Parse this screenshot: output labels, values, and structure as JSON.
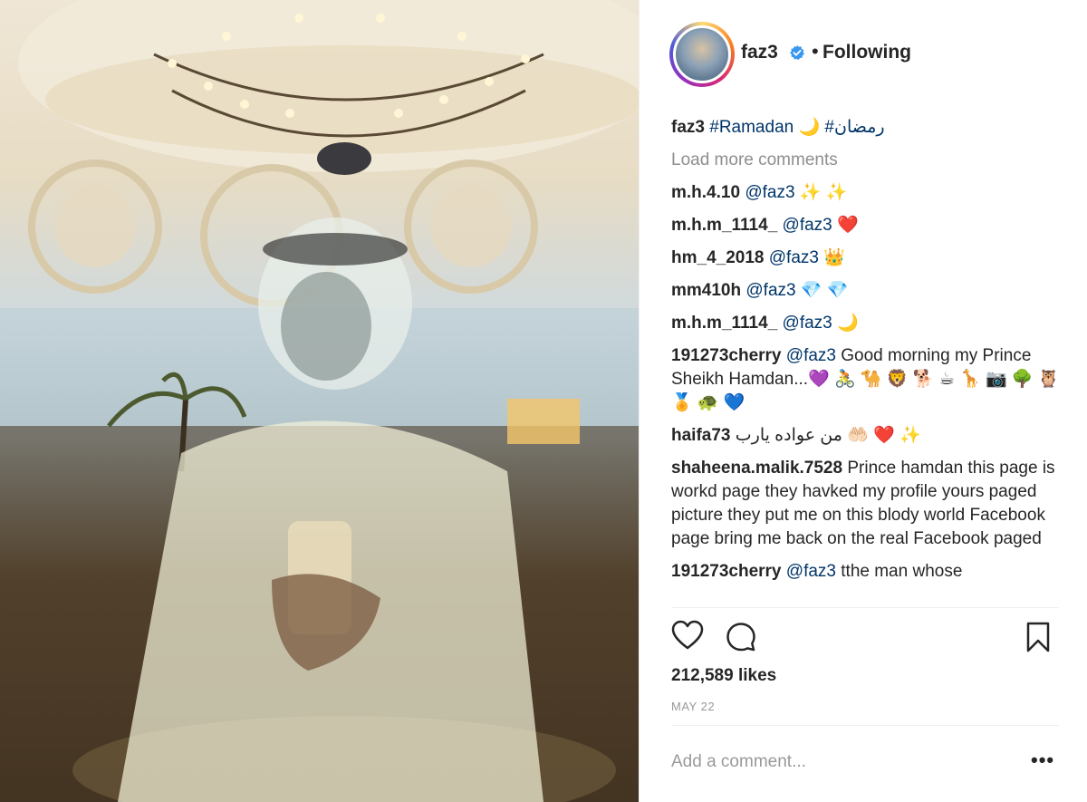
{
  "header": {
    "username": "faz3",
    "separator": "•",
    "follow_status": "Following"
  },
  "caption": {
    "username": "faz3",
    "text_parts": [
      "#Ramadan 🌙",
      "#رمضان"
    ]
  },
  "load_more": "Load more comments",
  "comments": [
    {
      "user": "m.h.4.10",
      "text": "@faz3 ✨ ✨"
    },
    {
      "user": "m.h.m_1114_",
      "text": "@faz3 ❤️"
    },
    {
      "user": "hm_4_2018",
      "text": "@faz3 👑"
    },
    {
      "user": "mm410h",
      "text": "@faz3 💎 💎"
    },
    {
      "user": "m.h.m_1114_",
      "text": "@faz3 🌙"
    },
    {
      "user": "191273cherry",
      "text": "@faz3 Good morning my Prince Sheikh Hamdan...💜 🚴 🐪 🦁 🐕 ☕ 🦒 📷 🌳 🦉 🏅 🐢 💙"
    },
    {
      "user": "haifa73",
      "text": "من عواده يارب 🤲🏻 ❤️ ✨"
    },
    {
      "user": "shaheena.malik.7528",
      "text": "Prince hamdan this page is workd page they havked my profile yours paged picture they put me on this blody world Facebook page bring me back on the real Facebook paged"
    },
    {
      "user": "191273cherry",
      "text": "@faz3 tthe man whose"
    }
  ],
  "likes": "212,589 likes",
  "date": "MAY 22",
  "add_comment_placeholder": "Add a comment...",
  "more_label": "•••",
  "icons": {
    "like": "heart-icon",
    "comment": "comment-bubble-icon",
    "save": "bookmark-icon",
    "verified": "verified-badge-icon"
  },
  "colors": {
    "text": "#262626",
    "muted": "#8e8e8e",
    "hashtag": "#003569",
    "verified": "#3897f0"
  }
}
